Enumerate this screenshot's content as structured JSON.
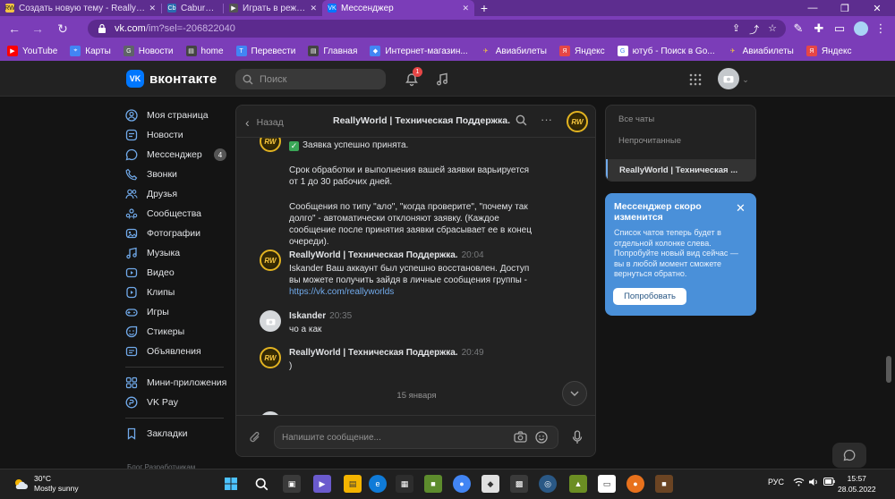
{
  "browser": {
    "tabs": [
      {
        "label": "Создать новую тему - ReallyWorld",
        "favicon_color": "#f4c542",
        "favicon_text": "RW"
      },
      {
        "label": "Cabura.sh",
        "favicon_color": "#2b6cb0",
        "favicon_text": "Cb"
      },
      {
        "label": "Играть в режим Майнкрафт",
        "favicon_color": "#555555",
        "favicon_text": "▶"
      },
      {
        "label": "Мессенджер",
        "favicon_color": "#0077ff",
        "favicon_text": "VK"
      }
    ],
    "url_host": "vk.com",
    "url_rest": "/im?sel=-206822040",
    "bookmarks": [
      {
        "label": "YouTube",
        "color": "#ff0000"
      },
      {
        "label": "Карты",
        "color": "#4285f4"
      },
      {
        "label": "Новости",
        "color": "#5f6368"
      },
      {
        "label": "home",
        "color": "#555555"
      },
      {
        "label": "Перевести",
        "color": "#4285f4"
      },
      {
        "label": "Главная",
        "color": "#555555"
      },
      {
        "label": "Интернет-магазин...",
        "color": "#4285f4"
      },
      {
        "label": "Авиабилеты",
        "color": "#f4c542"
      },
      {
        "label": "Яндекс",
        "color": "#e64646"
      },
      {
        "label": "ютуб - Поиск в Go...",
        "color": "#ffffff"
      },
      {
        "label": "Авиабилеты",
        "color": "#f4c542"
      },
      {
        "label": "Яндекс",
        "color": "#e64646"
      }
    ]
  },
  "vk": {
    "logo_text": "вконтакте",
    "logo_square": "VK",
    "search_placeholder": "Поиск",
    "notifications_count": "1",
    "accent": "#0077ff"
  },
  "nav": {
    "items": [
      {
        "label": "Моя страница",
        "icon": "user-circle-icon"
      },
      {
        "label": "Новости",
        "icon": "news-icon"
      },
      {
        "label": "Мессенджер",
        "icon": "chat-icon",
        "count": "4"
      },
      {
        "label": "Звонки",
        "icon": "phone-icon"
      },
      {
        "label": "Друзья",
        "icon": "friends-icon"
      },
      {
        "label": "Сообщества",
        "icon": "communities-icon"
      },
      {
        "label": "Фотографии",
        "icon": "photo-icon"
      },
      {
        "label": "Музыка",
        "icon": "music-icon"
      },
      {
        "label": "Видео",
        "icon": "video-icon"
      },
      {
        "label": "Клипы",
        "icon": "clips-icon"
      },
      {
        "label": "Игры",
        "icon": "games-icon"
      },
      {
        "label": "Стикеры",
        "icon": "stickers-icon"
      },
      {
        "label": "Объявления",
        "icon": "ads-icon"
      }
    ],
    "items2": [
      {
        "label": "Мини-приложения",
        "icon": "apps-icon"
      },
      {
        "label": "VK Pay",
        "icon": "vkpay-icon"
      }
    ],
    "items3": [
      {
        "label": "Закладки",
        "icon": "bookmark-icon"
      }
    ],
    "footer": "Блог   Разработчикам"
  },
  "chat": {
    "back_label": "Назад",
    "title": "ReallyWorld | Техническая Поддержка.",
    "avatar_text": "RW",
    "messages": {
      "m1_line1": "Заявка успешно принята.",
      "m1_line2": "Срок обработки и выполнения вашей заявки варьируется от 1 до 30 рабочих дней.",
      "m1_line3": "Сообщения по типу \"ало\", \"когда проверите\", \"почему так долго\" - автоматически отклоняют заявку. (Каждое сообщение после принятия заявки сбрасывает ее в конец очереди).",
      "m2_author": "ReallyWorld | Техническая Поддержка.",
      "m2_time": "20:04",
      "m2_text": "Iskander Ваш аккаунт был успешно восстановлен. Доступ вы можете получить зайдя в личные сообщения группы - ",
      "m2_link": "https://vk.com/reallyworlds",
      "m3_author": "Iskander",
      "m3_time": "20:35",
      "m3_text": "чо а как",
      "m4_author": "ReallyWorld | Техническая Поддержка.",
      "m4_time": "20:49",
      "m4_text": ")",
      "date_separator": "15 января"
    },
    "composer_placeholder": "Напишите сообщение..."
  },
  "folders": {
    "all": "Все чаты",
    "unread": "Непрочитанные",
    "active": "ReallyWorld | Техническая ..."
  },
  "notice": {
    "title": "Мессенджер скоро изменится",
    "body": "Список чатов теперь будет в отдельной колонке слева. Попробуйте новый вид сейчас — вы в любой момент сможете вернуться обратно.",
    "button": "Попробовать",
    "color": "#4a90d9"
  },
  "taskbar": {
    "weather_temp": "30°C",
    "weather_desc": "Mostly sunny",
    "lang": "РУС",
    "time": "15:57",
    "date": "28.05.2022"
  }
}
